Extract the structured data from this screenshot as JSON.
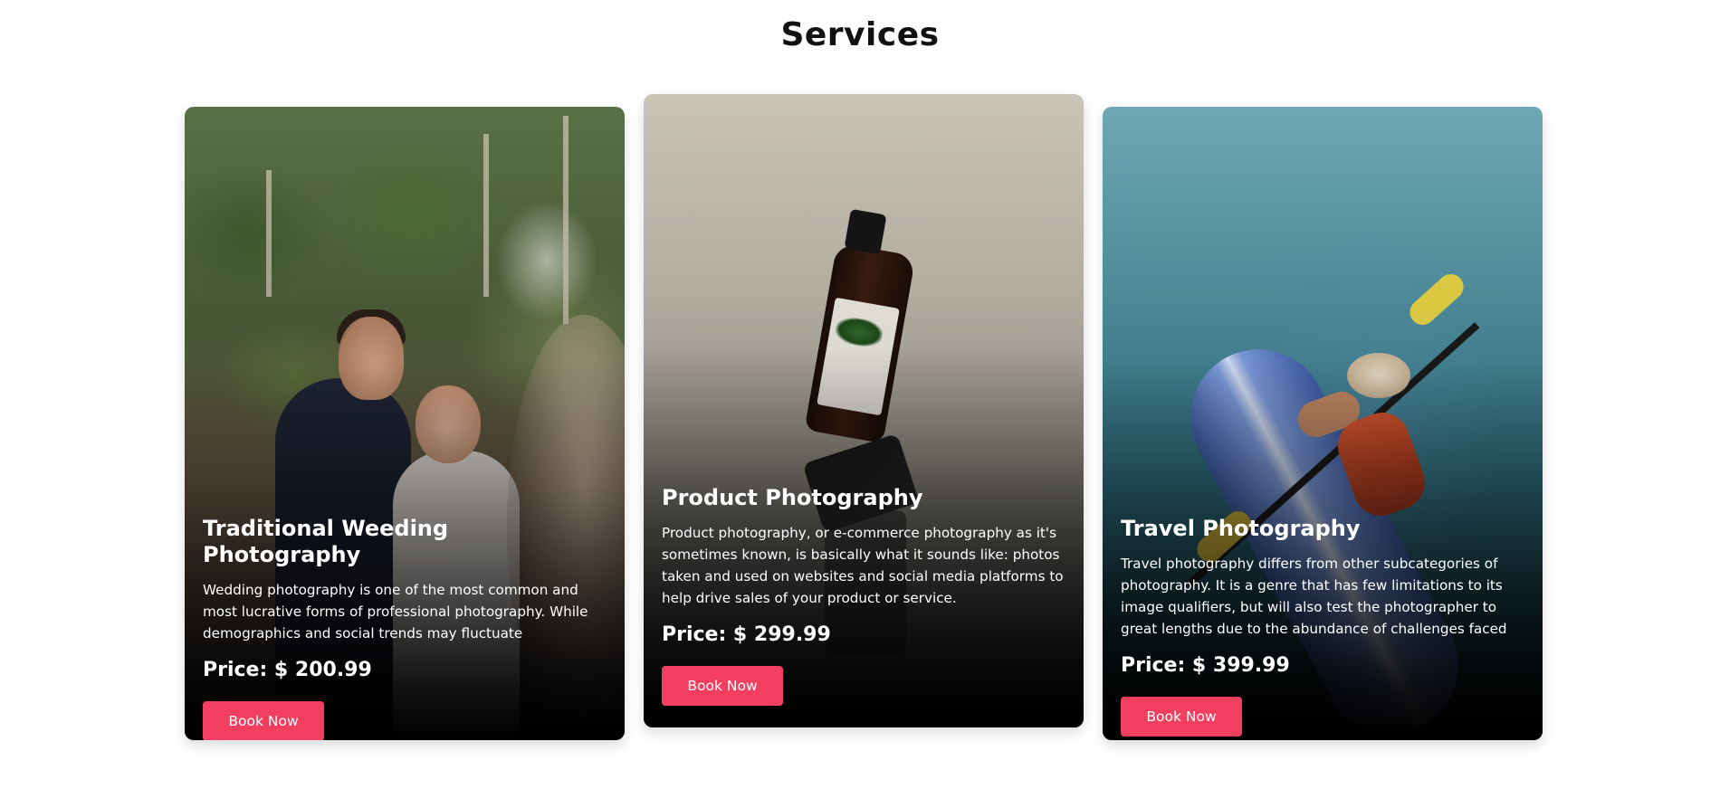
{
  "section": {
    "title": "Services"
  },
  "colors": {
    "accent": "#f23f5f",
    "text_light": "#ffffff",
    "heading": "#111111"
  },
  "cards": [
    {
      "image": "wedding-couple-photo",
      "title": "Traditional Weeding Photography",
      "description": "Wedding photography is one of the most common and most lucrative forms of professional photography. While demographics and social trends may fluctuate",
      "price": "Price: $ 200.99",
      "button_label": "Book Now"
    },
    {
      "image": "product-bottle-photo",
      "title": "Product Photography",
      "description": "Product photography, or e-commerce photography as it's sometimes known, is basically what it sounds like: photos taken and used on websites and social media platforms to help drive sales of your product or service.",
      "price": "Price: $ 299.99",
      "button_label": "Book Now"
    },
    {
      "image": "kayak-travel-photo",
      "title": "Travel Photography",
      "description": "Travel photography differs from other subcategories of photography. It is a genre that has few limitations to its image qualifiers, but will also test the photographer to great lengths due to the abundance of challenges faced",
      "price": "Price: $ 399.99",
      "button_label": "Book Now"
    }
  ]
}
